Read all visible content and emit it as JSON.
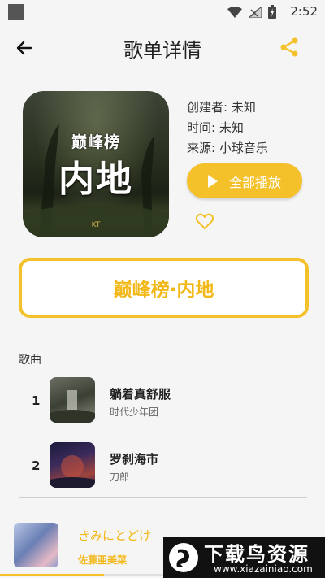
{
  "status_bar": {
    "time": "2:52"
  },
  "header": {
    "title": "歌单详情"
  },
  "playlist": {
    "cover_logo_text": "巅峰榜",
    "cover_big_text": "内地",
    "creator": "创建者: 未知",
    "time": "时间: 未知",
    "source": "来源: 小球音乐",
    "play_all_label": "全部播放",
    "name": "巅峰榜·内地"
  },
  "songs_section": {
    "label": "歌曲",
    "items": [
      {
        "index": "1",
        "title": "躺着真舒服",
        "artist": "时代少年团"
      },
      {
        "index": "2",
        "title": "罗刹海市",
        "artist": "刀郎"
      }
    ]
  },
  "now_playing": {
    "title": "きみにとどけ",
    "artist": "佐藤亜美菜",
    "progress": 0.32
  },
  "watermark": {
    "text": "下载鸟资源",
    "url": "www.xiazainiao.com"
  },
  "colors": {
    "accent": "#f4c12b",
    "accent_text": "#f2b818",
    "background": "#f5f5f5"
  },
  "icons": [
    "back-arrow-icon",
    "share-icon",
    "play-icon",
    "heart-outline-icon",
    "wifi-icon",
    "signal-icon",
    "battery-icon"
  ]
}
